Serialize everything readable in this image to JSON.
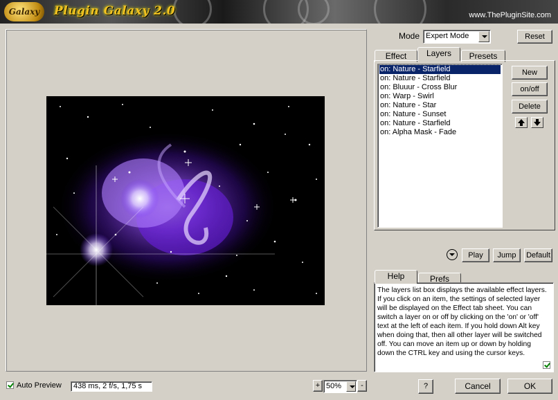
{
  "banner": {
    "logo_text": "Galaxy",
    "title": "Plugin Galaxy 2.0",
    "url": "www.ThePluginSite.com"
  },
  "mode": {
    "label": "Mode",
    "value": "Expert Mode"
  },
  "reset_label": "Reset",
  "tabs": {
    "effect": "Effect",
    "layers": "Layers",
    "presets": "Presets"
  },
  "layers": [
    "on:  Nature - Starfield",
    "on:  Nature - Starfield",
    "on:  Bluuur - Cross Blur",
    "on:  Warp - Swirl",
    "on:  Nature - Star",
    "on:  Nature - Sunset",
    "on:  Nature - Starfield",
    "on:  Alpha Mask - Fade"
  ],
  "selected_layer_index": 0,
  "layer_buttons": {
    "new": "New",
    "onoff": "on/off",
    "delete": "Delete"
  },
  "playback": {
    "play": "Play",
    "jump": "Jump",
    "default": "Default"
  },
  "bottom_tabs": {
    "help": "Help",
    "prefs": "Prefs"
  },
  "help_text": "The layers list box displays the available effect layers. If you click on an item, the settings of selected layer will be displayed on the Effect tab sheet. You can switch a layer on or off by clicking on the 'on' or 'off' text at the left of each item. If you hold down Alt key when doing that, then all other layer will be switched off. You can move an item up or down by holding down the CTRL key and using the cursor keys.",
  "footer": {
    "auto_preview": "Auto Preview",
    "status": "438 ms, 2 f/s, 1,75 s",
    "zoom_plus": "+",
    "zoom_value": "50%",
    "zoom_minus": "-",
    "help_button": "?",
    "cancel": "Cancel",
    "ok": "OK"
  },
  "colors": {
    "selection": "#0a246a",
    "nebula_violet": "#7a2cff",
    "check_green": "#008000"
  }
}
